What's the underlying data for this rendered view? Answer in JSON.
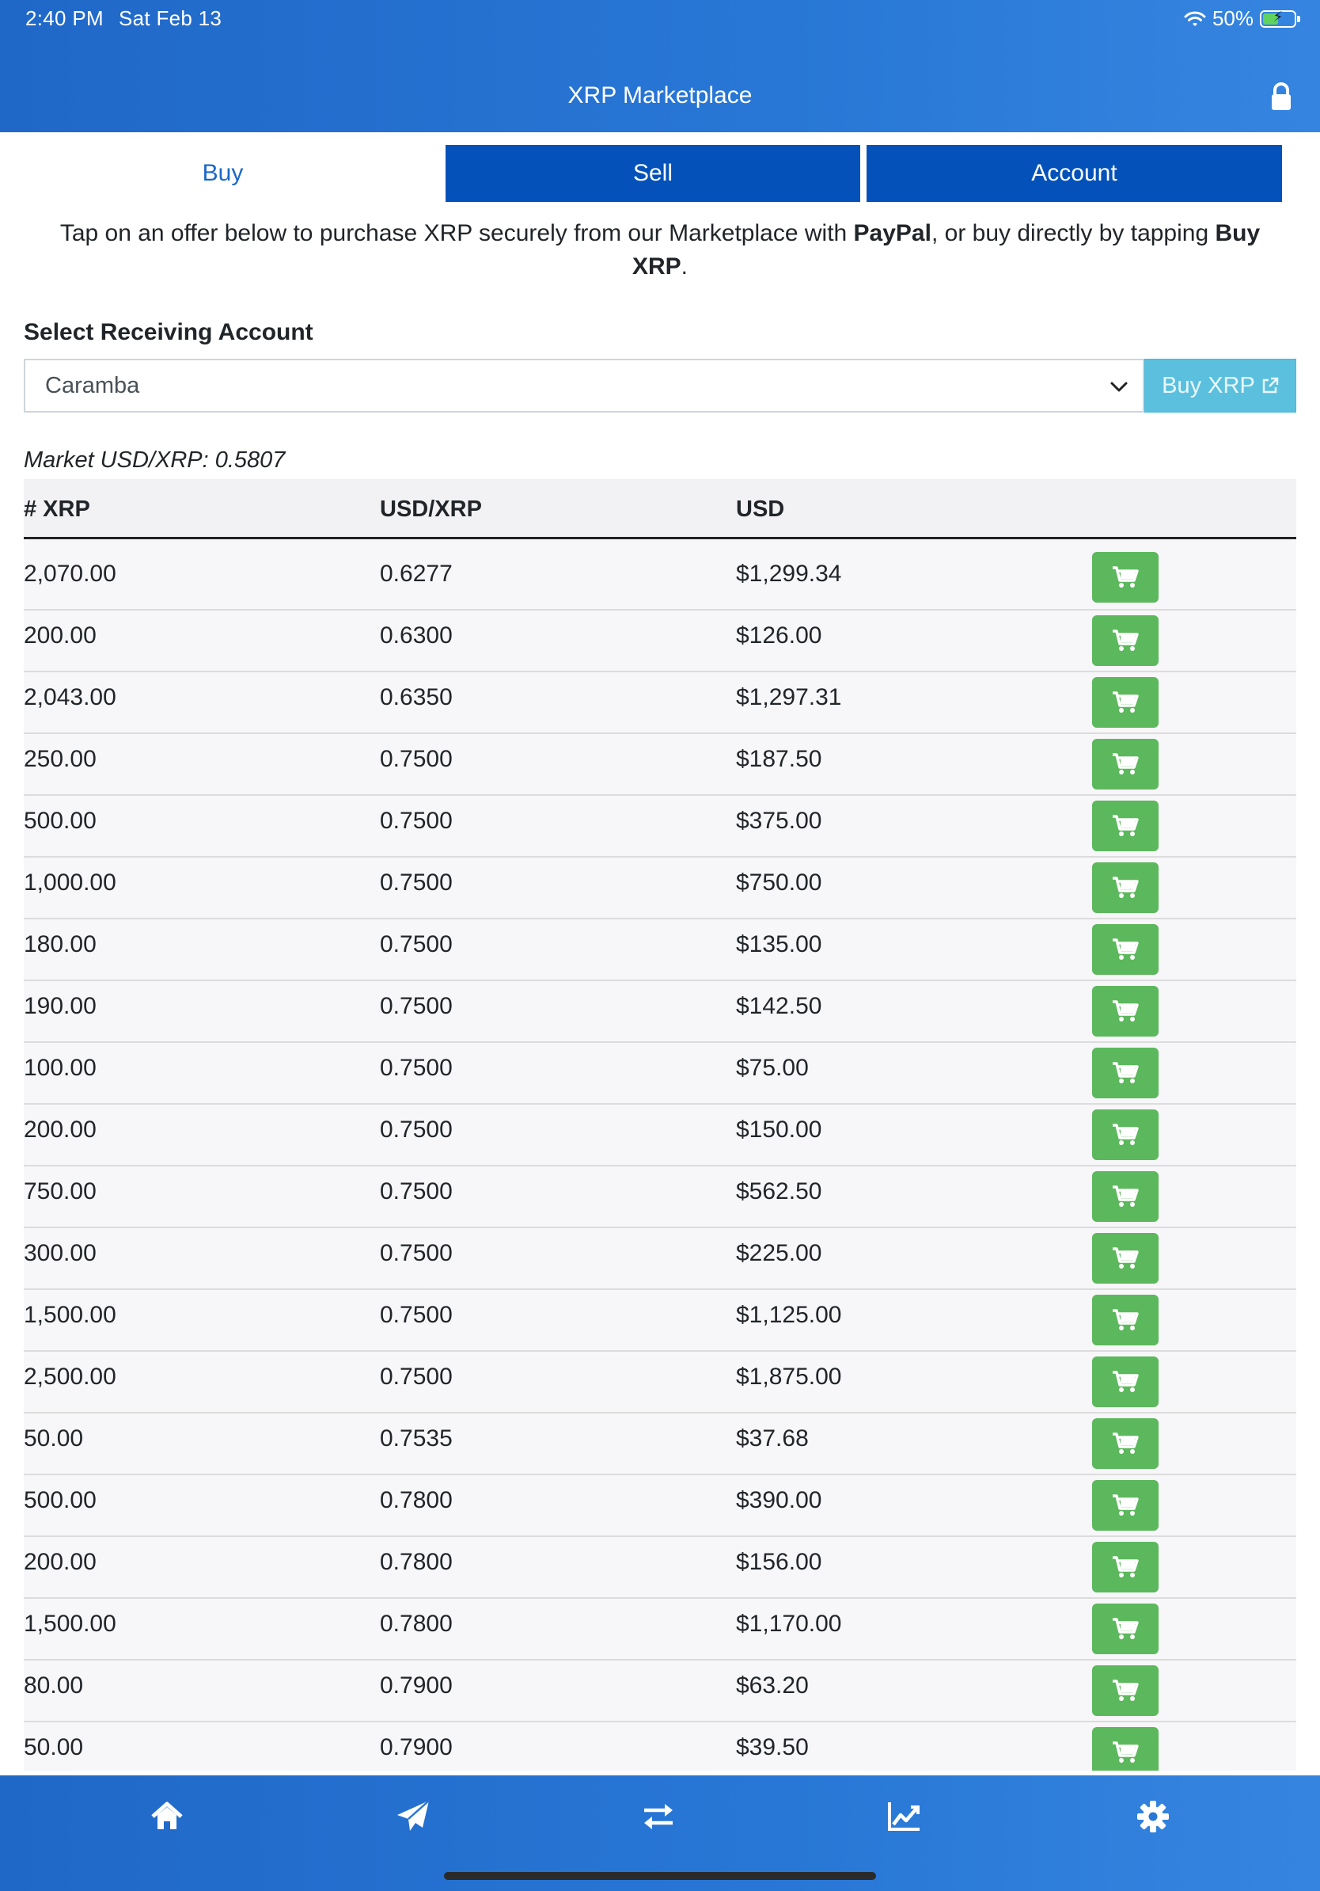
{
  "status_bar": {
    "time": "2:40 PM",
    "date": "Sat Feb 13",
    "battery": "50%",
    "battery_level": 0.5
  },
  "header": {
    "title": "XRP Marketplace",
    "lock_icon": "lock-icon"
  },
  "tabs": [
    {
      "label": "Buy",
      "active": true
    },
    {
      "label": "Sell",
      "active": false
    },
    {
      "label": "Account",
      "active": false
    }
  ],
  "intro": {
    "part1": "Tap on an offer below to purchase XRP securely from our Marketplace with ",
    "bold1": "PayPal",
    "part2": ", or buy directly by tapping ",
    "bold2": "Buy XRP",
    "part3": "."
  },
  "receiving": {
    "label": "Select Receiving Account",
    "selected": "Caramba",
    "buy_button": "Buy XRP"
  },
  "market": {
    "text": "Market USD/XRP: 0.5807"
  },
  "table": {
    "headers": [
      "# XRP",
      "USD/XRP",
      "USD"
    ],
    "rows": [
      [
        "2,070.00",
        "0.6277",
        "$1,299.34"
      ],
      [
        "200.00",
        "0.6300",
        "$126.00"
      ],
      [
        "2,043.00",
        "0.6350",
        "$1,297.31"
      ],
      [
        "250.00",
        "0.7500",
        "$187.50"
      ],
      [
        "500.00",
        "0.7500",
        "$375.00"
      ],
      [
        "1,000.00",
        "0.7500",
        "$750.00"
      ],
      [
        "180.00",
        "0.7500",
        "$135.00"
      ],
      [
        "190.00",
        "0.7500",
        "$142.50"
      ],
      [
        "100.00",
        "0.7500",
        "$75.00"
      ],
      [
        "200.00",
        "0.7500",
        "$150.00"
      ],
      [
        "750.00",
        "0.7500",
        "$562.50"
      ],
      [
        "300.00",
        "0.7500",
        "$225.00"
      ],
      [
        "1,500.00",
        "0.7500",
        "$1,125.00"
      ],
      [
        "2,500.00",
        "0.7500",
        "$1,875.00"
      ],
      [
        "50.00",
        "0.7535",
        "$37.68"
      ],
      [
        "500.00",
        "0.7800",
        "$390.00"
      ],
      [
        "200.00",
        "0.7800",
        "$156.00"
      ],
      [
        "1,500.00",
        "0.7800",
        "$1,170.00"
      ],
      [
        "80.00",
        "0.7900",
        "$63.20"
      ],
      [
        "50.00",
        "0.7900",
        "$39.50"
      ]
    ]
  },
  "bottom_nav": [
    "home-icon",
    "send-icon",
    "exchange-icon",
    "chart-icon",
    "gear-icon"
  ],
  "colors": {
    "header": "#2877d6",
    "tab_inactive": "#0452b9",
    "cart": "#5cb85c",
    "buy_xrp": "#5bc0de"
  }
}
